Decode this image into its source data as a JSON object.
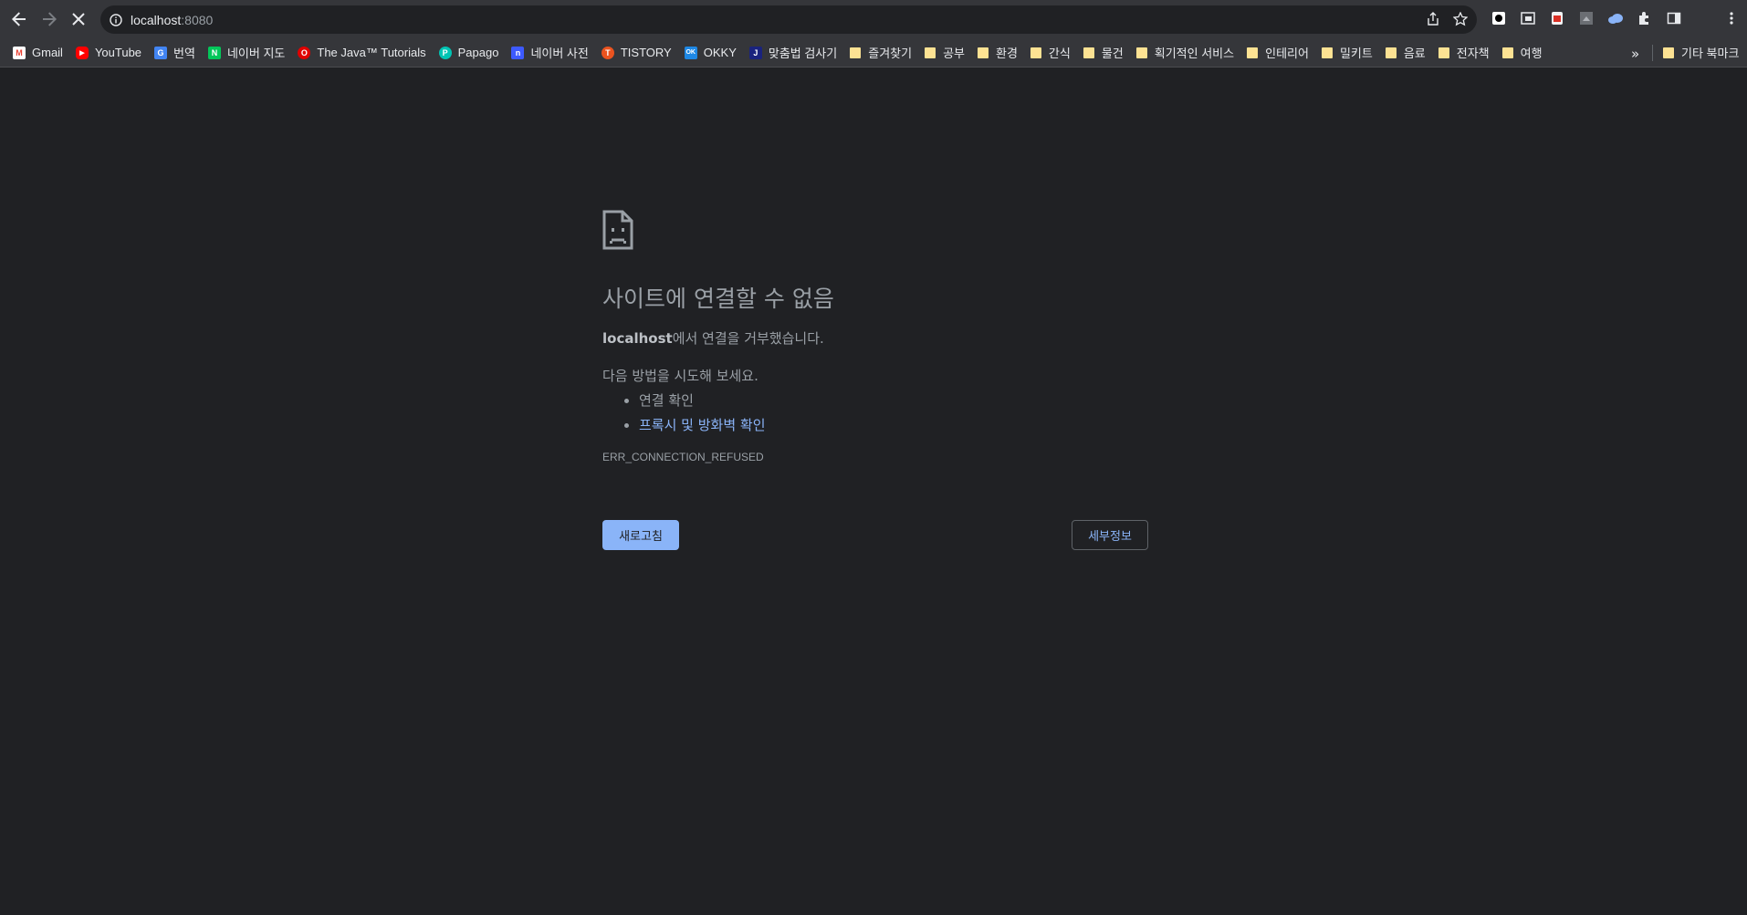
{
  "browser": {
    "url_host": "localhost",
    "url_port": ":8080"
  },
  "bookmarks": [
    {
      "label": "Gmail",
      "icon": "gmail-icon",
      "color": "#ea4335",
      "glyph": "M"
    },
    {
      "label": "YouTube",
      "icon": "youtube-icon",
      "color": "#ff0000",
      "glyph": "▶"
    },
    {
      "label": "번역",
      "icon": "google-translate-icon",
      "color": "#4285f4",
      "glyph": "G"
    },
    {
      "label": "네이버 지도",
      "icon": "naver-map-icon",
      "color": "#03c75a",
      "glyph": "N"
    },
    {
      "label": "The Java™ Tutorials",
      "icon": "oracle-icon",
      "color": "#e00000",
      "glyph": "O"
    },
    {
      "label": "Papago",
      "icon": "papago-icon",
      "color": "#00c4b4",
      "glyph": "P"
    },
    {
      "label": "네이버 사전",
      "icon": "naver-dictionary-icon",
      "color": "#3d5afe",
      "glyph": "n"
    },
    {
      "label": "TISTORY",
      "icon": "tistory-icon",
      "color": "#eb531f",
      "glyph": "T"
    },
    {
      "label": "OKKY",
      "icon": "okky-icon",
      "color": "#1e88e5",
      "glyph": "OK"
    },
    {
      "label": "맞춤법 검사기",
      "icon": "spellcheck-icon",
      "color": "#1a237e",
      "glyph": "J"
    }
  ],
  "folders": [
    "즐겨찾기",
    "공부",
    "환경",
    "간식",
    "물건",
    "획기적인 서비스",
    "인테리어",
    "밀키트",
    "음료",
    "전자책",
    "여행"
  ],
  "more_bookmarks_glyph": "»",
  "other_bookmarks": "기타 북마크",
  "error": {
    "heading": "사이트에 연결할 수 없음",
    "host": "localhost",
    "message": "에서 연결을 거부했습니다.",
    "suggest_title": "다음 방법을 시도해 보세요.",
    "suggestions": [
      "연결 확인",
      "프록시 및 방화벽 확인"
    ],
    "code": "ERR_CONNECTION_REFUSED"
  },
  "buttons": {
    "reload": "새로고침",
    "details": "세부정보"
  }
}
